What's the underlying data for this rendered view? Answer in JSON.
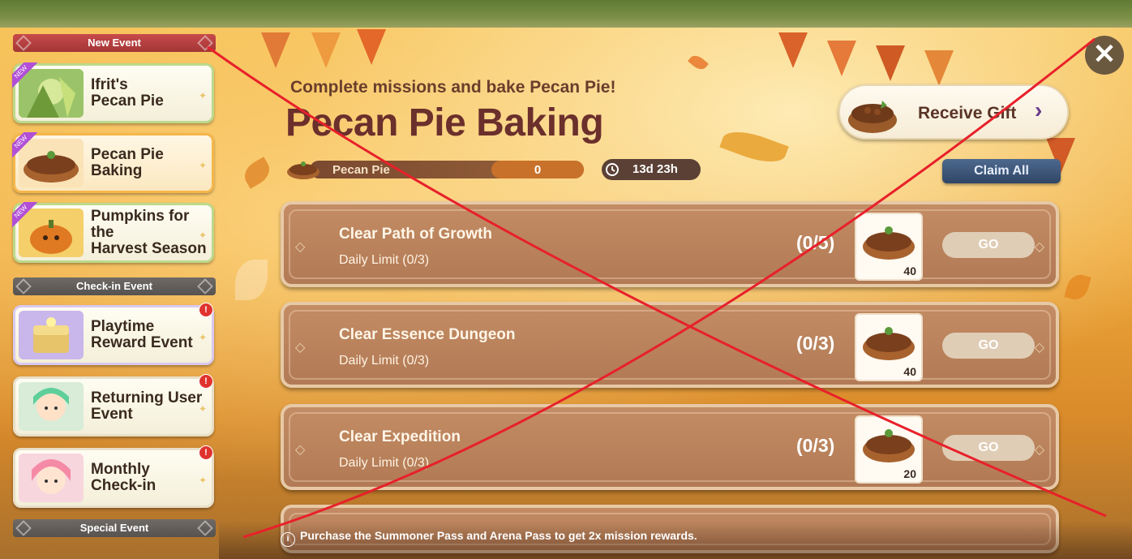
{
  "sidebar": {
    "categories": {
      "new_event": "New Event",
      "checkin_event": "Check-in Event",
      "special_event": "Special Event"
    },
    "new_tag": "NEW",
    "alert_mark": "!",
    "items": [
      {
        "label": "Ifrit's\nPecan Pie",
        "icon": "ifrit-character-thumbnail"
      },
      {
        "label": "Pecan Pie\nBaking",
        "icon": "pecan-pie-thumbnail"
      },
      {
        "label": "Pumpkins for\nthe\nHarvest Season",
        "icon": "pumpkin-thumbnail"
      },
      {
        "label": "Playtime\nReward Event",
        "icon": "treasure-chest-thumbnail"
      },
      {
        "label": "Returning User\nEvent",
        "icon": "green-hair-character-thumbnail"
      },
      {
        "label": "Monthly\nCheck-in",
        "icon": "pink-hair-character-thumbnail"
      }
    ]
  },
  "header": {
    "subtitle": "Complete missions and bake Pecan Pie!",
    "title": "Pecan Pie Baking",
    "currency_name": "Pecan Pie",
    "currency_value": "0",
    "timer": "13d 23h",
    "receive_gift": "Receive Gift",
    "claim_all": "Claim All",
    "close": "✕"
  },
  "missions": [
    {
      "title": "Clear Path of Growth",
      "limit": "Daily Limit (0/3)",
      "progress": "(0/5)",
      "reward_qty": "40",
      "go": "GO"
    },
    {
      "title": "Clear Essence Dungeon",
      "limit": "Daily Limit (0/3)",
      "progress": "(0/3)",
      "reward_qty": "40",
      "go": "GO"
    },
    {
      "title": "Clear Expedition",
      "limit": "Daily Limit (0/3)",
      "progress": "(0/3)",
      "reward_qty": "20",
      "go": "GO"
    }
  ],
  "footer": {
    "info_icon": "i",
    "note": "Purchase the Summoner Pass and Arena Pass to get 2x mission rewards."
  },
  "colors": {
    "accent_red_cross": "#e8202a",
    "title_brown": "#6b2f2c",
    "mission_card": "#b17a55",
    "claim_all_blue": "#2f4566"
  }
}
